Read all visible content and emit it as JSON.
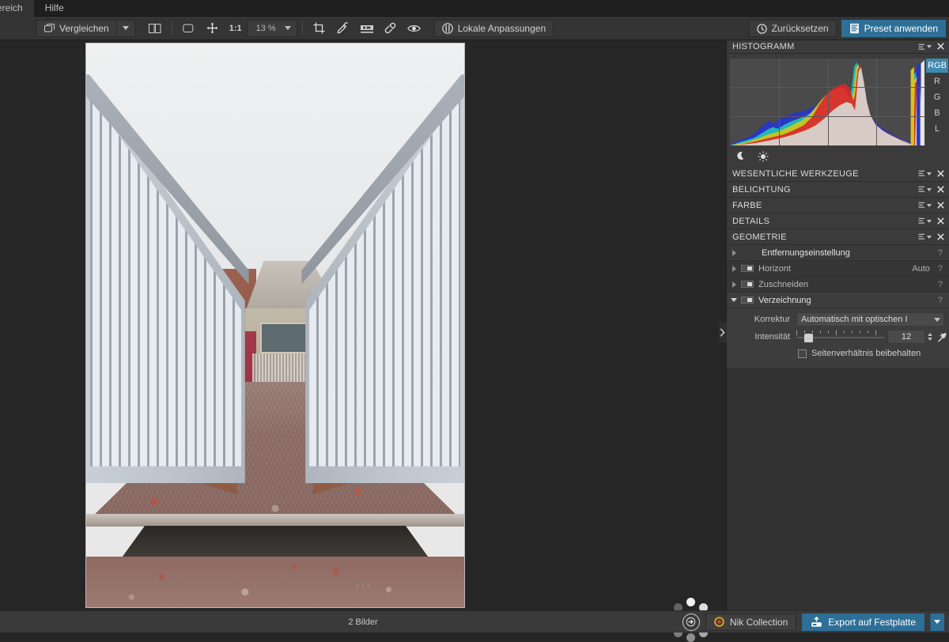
{
  "menubar": {
    "items": [
      {
        "label": "ereich"
      },
      {
        "label": "Hilfe"
      }
    ]
  },
  "toolbar": {
    "compare_label": "Vergleichen",
    "compare_icon": "compare-icon",
    "split_icon": "split-view-icon",
    "fit_icon": "fit-screen-icon",
    "pan_icon": "pan-hand-icon",
    "one_to_one": "1:1",
    "zoom_value": "13 %",
    "crop_icon": "crop-icon",
    "eyedropper_icon": "eyedropper-icon",
    "repair_icon": "repair-brush-icon",
    "eraser_icon": "eraser-icon",
    "eye_icon": "eye-preview-icon",
    "local_adjust_label": "Lokale Anpassungen",
    "local_adjust_icon": "local-adjustments-icon",
    "reset_label": "Zurücksetzen",
    "reset_icon": "history-reset-icon",
    "preset_label": "Preset anwenden",
    "preset_icon": "preset-icon",
    "accent_color": "#2d6f96"
  },
  "histogram": {
    "title": "HISTOGRAMM",
    "menu_icon": "panel-menu-icon",
    "close_icon": "close-icon",
    "channels": [
      "RGB",
      "R",
      "G",
      "B",
      "L"
    ],
    "active_channel": "RGB",
    "shadow_icon": "moon-shadow-clip-icon",
    "highlight_icon": "sun-highlight-clip-icon"
  },
  "sections": [
    {
      "title": "WESENTLICHE WERKZEUGE"
    },
    {
      "title": "BELICHTUNG"
    },
    {
      "title": "FARBE"
    },
    {
      "title": "DETAILS"
    },
    {
      "title": "GEOMETRIE"
    }
  ],
  "geometry": {
    "rows": [
      {
        "label": "Entfernungseinstellung",
        "has_toggle": false,
        "open": false,
        "right": "",
        "help": "?"
      },
      {
        "label": "Horizont",
        "has_toggle": true,
        "open": false,
        "right": "Auto",
        "help": "?"
      },
      {
        "label": "Zuschneiden",
        "has_toggle": true,
        "open": false,
        "right": "",
        "help": "?"
      },
      {
        "label": "Verzeichnung",
        "has_toggle": true,
        "open": true,
        "right": "",
        "help": "?"
      }
    ],
    "distortion": {
      "correction_label": "Korrektur",
      "correction_value": "Automatisch mit optischen I",
      "intensity_label": "Intensität",
      "intensity_value": "12",
      "wand_icon": "auto-wand-icon",
      "keep_aspect_label": "Seitenverhältnis beibehalten",
      "keep_aspect_checked": false
    }
  },
  "panel": {
    "collapse_icon": "chevron-right-icon"
  },
  "canvas": {
    "loading_icon": "loading-spinner-icon",
    "filmstrip_handle_icon": "drag-handle-icon"
  },
  "bottombar": {
    "image_count": "2 Bilder",
    "fullscreen_icon": "present-arrow-icon",
    "nik_label": "Nik Collection",
    "nik_icon": "nik-collection-icon",
    "export_label": "Export auf Festplatte",
    "export_icon": "export-disk-icon",
    "export_caret_icon": "chevron-down-icon"
  }
}
